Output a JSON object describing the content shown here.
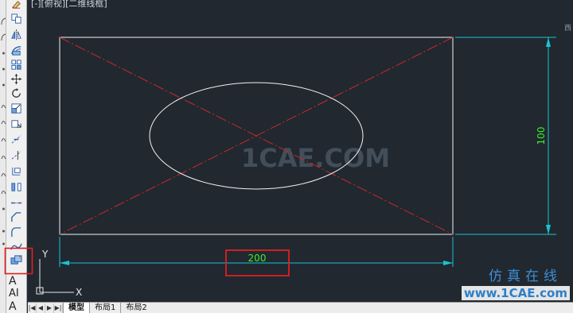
{
  "viewport": {
    "label": "[-][俯视][二维线框]"
  },
  "toolbar": {
    "tools": [
      "erase-icon",
      "copy-icon",
      "mirror-icon",
      "offset-icon",
      "array-icon",
      "move-icon",
      "rotate-icon",
      "scale-icon",
      "stretch-icon",
      "trim-icon",
      "extend-icon",
      "break-at-point-icon",
      "break-icon",
      "join-icon",
      "chamfer-icon",
      "fillet-icon",
      "blend-curves-icon",
      "explode-icon"
    ],
    "text_tools": [
      "A",
      "AI",
      "A"
    ]
  },
  "drawing": {
    "dimension_horizontal": "200",
    "dimension_vertical": "100",
    "ucs_y": "Y",
    "ucs_x": "X",
    "colors": {
      "rectangle": "#f2f2f2",
      "centerline": "#c8282a",
      "ellipse": "#f2f2f2",
      "dimension": "#18c4d2",
      "dimension_text": "#3cf02c",
      "highlight": "#e02020"
    }
  },
  "watermark": "1CAE.COM",
  "right_hint": "西",
  "logo": {
    "cn": "仿真在线",
    "url": "www.1CAE.com"
  },
  "tabs": {
    "nav": [
      "|◀",
      "◀",
      "▶",
      "▶|"
    ],
    "items": [
      "模型",
      "布局1",
      "布局2"
    ]
  }
}
